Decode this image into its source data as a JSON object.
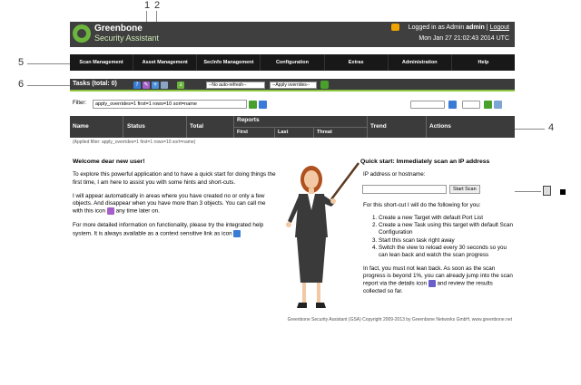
{
  "callouts": {
    "c1": "1",
    "c2": "2",
    "c4": "4",
    "c5": "5",
    "c6": "6"
  },
  "header": {
    "brand_line1": "Greenbone",
    "brand_line2": "Security Assistant",
    "login_text": "Logged in as Admin",
    "username": "admin",
    "separator": "|",
    "logout": "Logout",
    "datetime": "Mon Jan 27 21:02:43 2014 UTC"
  },
  "menu": [
    "Scan Management",
    "Asset Management",
    "SecInfo Management",
    "Configuration",
    "Extras",
    "Administration",
    "Help"
  ],
  "tasks_bar": {
    "title": "Tasks (total: 0)",
    "refresh_select": "--No auto-refresh--",
    "overrides_select": "--Apply overrides--"
  },
  "filter": {
    "label": "Filter:",
    "value": "apply_overrides=1 first=1 rows=10 sort=name"
  },
  "table": {
    "headers": {
      "name": "Name",
      "status": "Status",
      "total": "Total",
      "reports": "Reports",
      "trend": "Trend",
      "actions": "Actions"
    },
    "subheaders": {
      "first": "First",
      "last": "Last",
      "threat": "Threat"
    },
    "applied_filter": "(Applied filter: apply_overrides=1 first=1 rows=10 sort=name)"
  },
  "welcome": {
    "title": "Welcome dear new user!",
    "p1": "To explore this powerful application and to have a quick start for doing things the first time, I am here to assist you with some hints and short-cuts.",
    "p2a": "I will appear automatically in areas where you have created no or only a few objects. And disappear when you have more than 3 objects. You can call me with this icon",
    "p2b": "any time later on.",
    "p3": "For more detailed information on functionality, please try the integrated help system. It is always available as a context sensitive link as icon"
  },
  "quick": {
    "title": "Quick start: Immediately scan an IP address",
    "ip_label": "IP address or hostname:",
    "button": "Start Scan",
    "intro": "For this short-cut I will do the following for you:",
    "steps": [
      "Create a new Target with default Port List",
      "Create a new Task using this target with default Scan Configuration",
      "Start this scan task right away",
      "Switch the view to reload every 30 seconds so you can lean back and watch the scan progress"
    ],
    "outro_a": "In fact, you must not lean back. As soon as the scan progress is beyond 1%, you can already jump into the scan report via the details icon",
    "outro_b": "and review the results collected so far."
  },
  "footer": "Greenbone Security Assistant (GSA) Copyright 2009-2013 by Greenbone Networks GmbH, www.greenbone.net",
  "colors": {
    "accent": "#8cc63f",
    "header_bg": "#3f3f3f",
    "menu_bg": "#181818"
  }
}
